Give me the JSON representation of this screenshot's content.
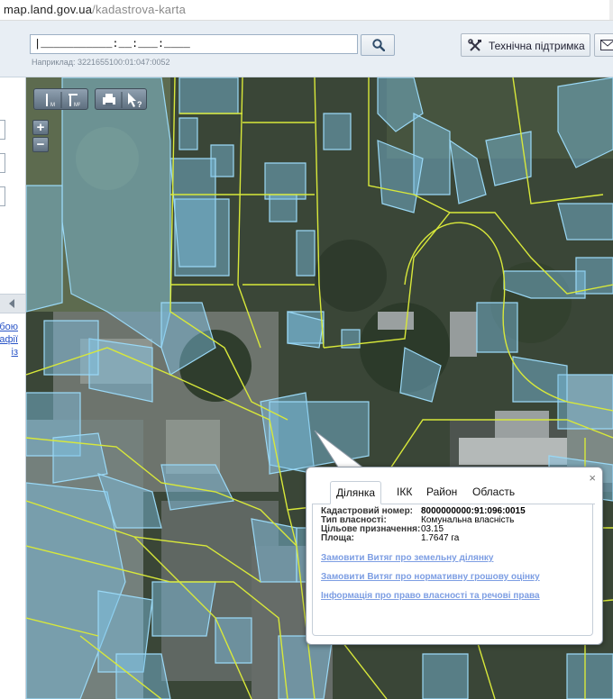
{
  "browser": {
    "url_host": "map.land.gov.ua",
    "url_path": "/kadastrova-karta"
  },
  "header": {
    "search_value": "|___________:__:___:____",
    "example": "Наприклад: 3221655100:01:047:0052",
    "support_label": "Технічна підтримка"
  },
  "left_panel": {
    "links": [
      "бою",
      "афії",
      "із"
    ]
  },
  "map_toolbar": {
    "tools": [
      "measure-length-icon",
      "measure-area-icon",
      "print-icon",
      "identify-icon"
    ],
    "zoom_in": "+",
    "zoom_out": "−",
    "colors": {
      "parcel_fill": "#7ec3e6",
      "parcel_stroke": "#9ad8f5",
      "boundary": "#d8e83a"
    }
  },
  "popup": {
    "close": "×",
    "tabs": [
      "Ділянка",
      "ІКК",
      "Район",
      "Область"
    ],
    "active_tab": "Ділянка",
    "fields": [
      {
        "label": "Кадастровий номер:",
        "value": "8000000000:91:096:0015"
      },
      {
        "label": "Тип власності:",
        "value": "Комунальна власність"
      },
      {
        "label": "Цільове призначення:",
        "value": "03.15"
      },
      {
        "label": "Площа:",
        "value": "1.7647 га"
      }
    ],
    "links": [
      "Замовити Витяг про земельну ділянку",
      "Замовити Витяг про нормативну грошову оцінку",
      "Інформація про право власності та речові права"
    ]
  }
}
